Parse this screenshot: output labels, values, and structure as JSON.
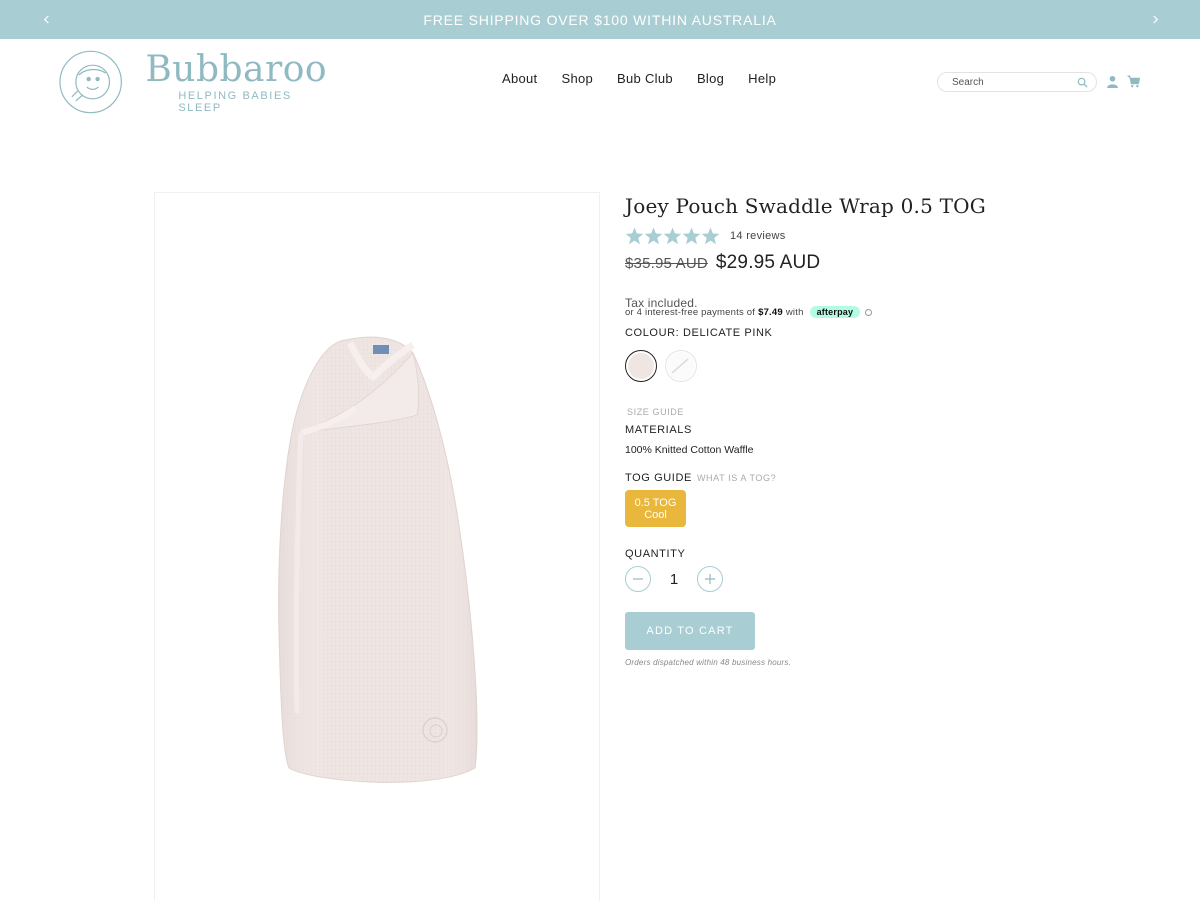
{
  "announcement": {
    "text": "FREE SHIPPING OVER $100 WITHIN AUSTRALIA",
    "prev_icon": "chevron-left-icon",
    "next_icon": "chevron-right-icon"
  },
  "header": {
    "brand_name": "Bubbaroo",
    "brand_tagline": "HELPING BABIES SLEEP",
    "nav": [
      "About",
      "Shop",
      "Bub Club",
      "Blog",
      "Help"
    ],
    "search_placeholder": "Search",
    "icons": [
      "search-icon",
      "account-icon",
      "cart-icon"
    ]
  },
  "product": {
    "title": "Joey Pouch Swaddle Wrap 0.5 TOG",
    "rating": 5,
    "reviews": "14 reviews",
    "old_price": "$35.95 AUD",
    "price": "$29.95 AUD",
    "tax_note": "Tax included.",
    "afterpay": {
      "prefix": "or 4 interest-free payments of",
      "amount": "$7.49",
      "with": "with",
      "badge": "afterpay"
    },
    "colour_label": "COLOUR: DELICATE PINK",
    "swatches": [
      {
        "name": "Delicate Pink",
        "color": "#efe5e2",
        "selected": true
      },
      {
        "name": "White",
        "color": "#ffffff",
        "selected": false
      }
    ],
    "size_guide": "SIZE GUIDE",
    "materials_label": "MATERIALS",
    "materials_value": "100% Knitted Cotton Waffle",
    "tog_label": "TOG GUIDE",
    "tog_help": "WHAT IS A TOG?",
    "tog_option_line1": "0.5 TOG",
    "tog_option_line2": "Cool",
    "quantity_label": "QUANTITY",
    "quantity": "1",
    "add_to_cart": "ADD TO CART",
    "dispatch_note": "Orders dispatched within 48 business hours."
  },
  "colors": {
    "accent": "#a8cdd3",
    "brand": "#8fbac2",
    "tog_yellow": "#e9b73b",
    "afterpay_mint": "#b2fce4",
    "star": "#a8cdd3",
    "product_pink": "#efe5e2"
  }
}
